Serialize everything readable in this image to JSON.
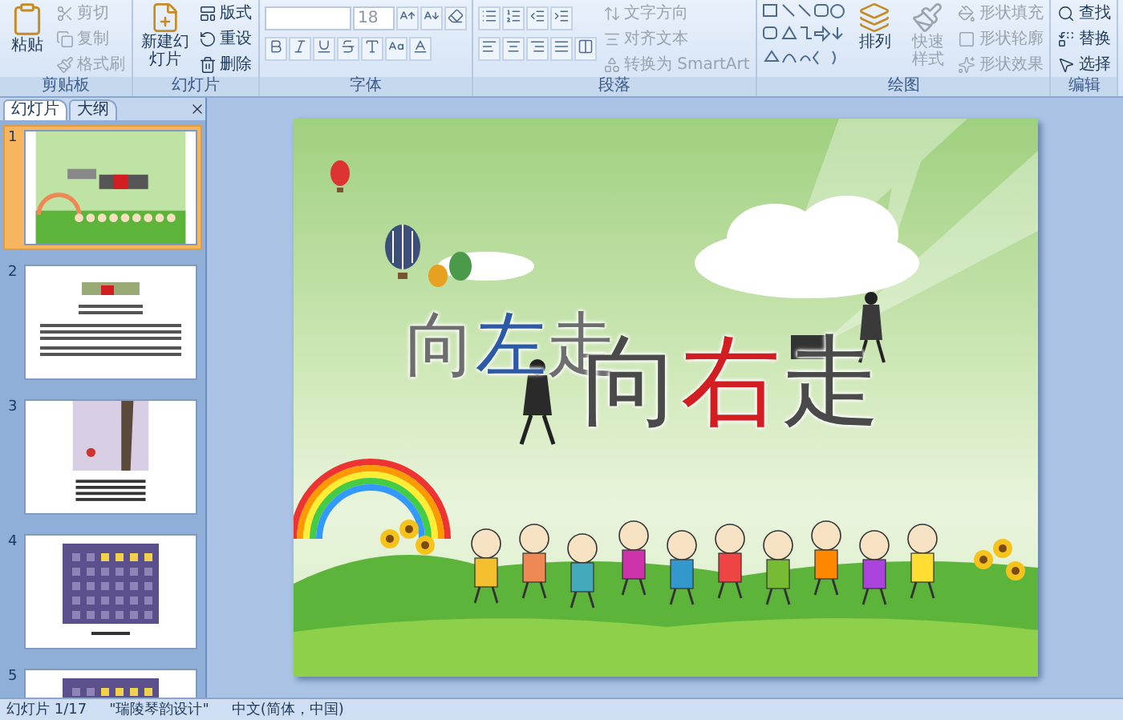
{
  "ribbon": {
    "groups": [
      {
        "kind": "clipboard",
        "label": "剪贴板",
        "large_button": {
          "label": "粘贴",
          "disabled": false
        },
        "buttons": [
          {
            "label": "剪切",
            "disabled": true
          },
          {
            "label": "复制",
            "disabled": true
          },
          {
            "label": "格式刷",
            "disabled": true
          }
        ]
      },
      {
        "kind": "slides",
        "label": "幻灯片",
        "large_button": {
          "label": "新建幻灯片",
          "disabled": false
        },
        "buttons": [
          {
            "label": "版式",
            "disabled": false
          },
          {
            "label": "重设",
            "disabled": false
          },
          {
            "label": "删除",
            "disabled": false
          }
        ]
      },
      {
        "kind": "font",
        "label": "字体",
        "font_size": "18"
      },
      {
        "kind": "paragraph",
        "label": "段落",
        "buttons": [
          {
            "label": "文字方向",
            "disabled": true
          },
          {
            "label": "对齐文本",
            "disabled": true
          },
          {
            "label": "转换为 SmartArt",
            "disabled": true
          }
        ]
      },
      {
        "kind": "drawing",
        "label": "绘图",
        "large_buttons": [
          {
            "label": "排列",
            "disabled": false
          },
          {
            "label": "快速样式",
            "disabled": true
          }
        ],
        "buttons": [
          {
            "label": "形状填充",
            "disabled": true
          },
          {
            "label": "形状轮廓",
            "disabled": true
          },
          {
            "label": "形状效果",
            "disabled": true
          }
        ]
      },
      {
        "kind": "editing",
        "label": "编辑",
        "buttons": [
          {
            "label": "查找",
            "disabled": false
          },
          {
            "label": "替换",
            "disabled": false
          },
          {
            "label": "选择",
            "disabled": false
          }
        ]
      }
    ]
  },
  "panel_tabs": [
    {
      "label": "幻灯片",
      "selected": true
    },
    {
      "label": "大纲",
      "selected": false
    }
  ],
  "thumbnails": [
    {
      "number": "1",
      "selected": true,
      "kind": "title"
    },
    {
      "number": "2",
      "selected": false,
      "kind": "text"
    },
    {
      "number": "3",
      "selected": false,
      "kind": "photo-text"
    },
    {
      "number": "4",
      "selected": false,
      "kind": "photo"
    },
    {
      "number": "5",
      "selected": false,
      "kind": "photo"
    }
  ],
  "slide": {
    "title_lines": [
      {
        "parts": [
          {
            "text": "向",
            "color": "#6e6e6e"
          },
          {
            "text": "左",
            "color": "#2d5aa6"
          },
          {
            "text": "走",
            "color": "#6e6e6e"
          }
        ]
      },
      {
        "parts": [
          {
            "text": "向",
            "color": "#4a4a4a"
          },
          {
            "text": "右",
            "color": "#d21e23"
          },
          {
            "text": "走",
            "color": "#4a4a4a"
          }
        ]
      }
    ]
  },
  "status_bar": [
    "幻灯片 1/17",
    "\"瑞陵琴韵设计\"",
    "中文(简体，中国)"
  ]
}
